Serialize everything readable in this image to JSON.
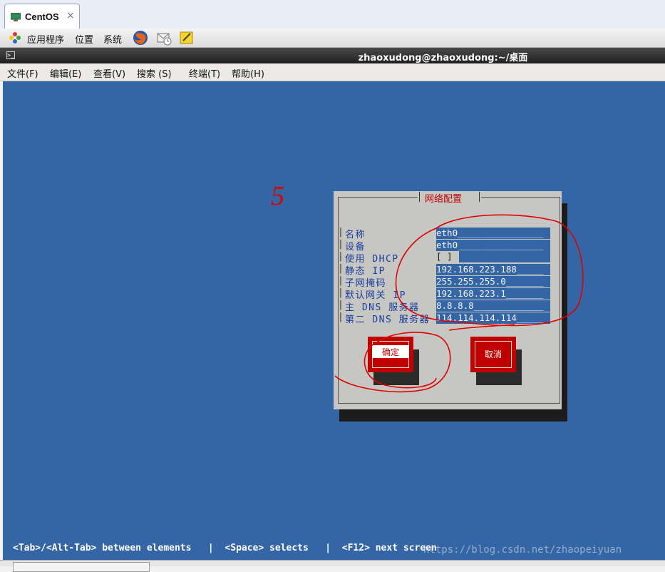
{
  "vm_tab": {
    "label": "CentOS",
    "close": "×"
  },
  "panel": {
    "menus": [
      "应用程序",
      "位置",
      "系统"
    ],
    "launchers": [
      "firefox-icon",
      "mail-icon",
      "notes-icon"
    ]
  },
  "terminal": {
    "title": "zhaoxudong@zhaoxudong:~/桌面",
    "menus": [
      "文件(F)",
      "编辑(E)",
      "查看(V)",
      "搜索 (S)",
      "终端(T)",
      "帮助(H)"
    ]
  },
  "dialog": {
    "title": "网络配置",
    "fields": [
      {
        "label": "名称",
        "value": "eth0________________"
      },
      {
        "label": "设备",
        "value": "eth0________________"
      },
      {
        "label": "使用 DHCP",
        "value": "[ ]"
      },
      {
        "label": "静态 IP",
        "value": "192.168.223.188_____"
      },
      {
        "label": "子网掩码",
        "value": "255.255.255.0_______"
      },
      {
        "label": "默认网关 IP",
        "value": "192.168.223.1_______"
      },
      {
        "label": "主 DNS 服务器",
        "value": "8.8.8.8_____________"
      },
      {
        "label": "第二 DNS 服务器",
        "value": "114.114.114.114_____"
      }
    ],
    "ok_label": "确定",
    "cancel_label": "取消"
  },
  "annotation": {
    "number": "5"
  },
  "hint": "<Tab>/<Alt-Tab> between elements   |  <Space> selects   |  <F12> next screen",
  "watermark": "https://blog.csdn.net/zhaopeiyuan",
  "colors": {
    "terminal_bg": "#3465a4",
    "dialog_bg": "#c6c6c2",
    "button": "#c00000",
    "label": "#1a3d9e",
    "annotation": "#e00000"
  }
}
